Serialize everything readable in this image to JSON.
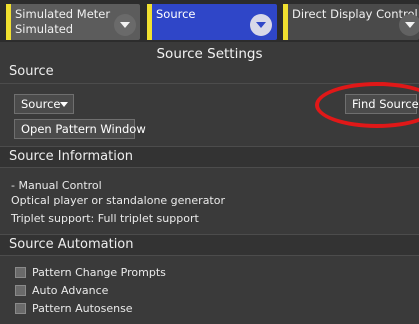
{
  "tabs": [
    {
      "line1": "Simulated Meter",
      "line2": "Simulated",
      "accent": "#f0e030"
    },
    {
      "line1": "Source",
      "line2": "",
      "accent": "#f0e030"
    },
    {
      "line1": "Direct Display Control",
      "line2": "",
      "accent": "#f0e030"
    }
  ],
  "panel_title": "Source Settings",
  "source_section": {
    "heading": "Source",
    "source_dropdown": "Source",
    "find_source_button": "Find Source",
    "open_pattern_button": "Open Pattern Window"
  },
  "info_section": {
    "heading": "Source Information",
    "lines": [
      "- Manual Control",
      "Optical player or standalone generator",
      "Triplet support: Full triplet support"
    ]
  },
  "automation_section": {
    "heading": "Source Automation",
    "options": [
      {
        "label": "Pattern Change Prompts",
        "checked": false
      },
      {
        "label": "Auto Advance",
        "checked": false
      },
      {
        "label": "Pattern Autosense",
        "checked": false
      }
    ]
  },
  "colors": {
    "active_tab": "#2f46c8",
    "annotation": "#e01818",
    "background": "#3a3a3a"
  }
}
